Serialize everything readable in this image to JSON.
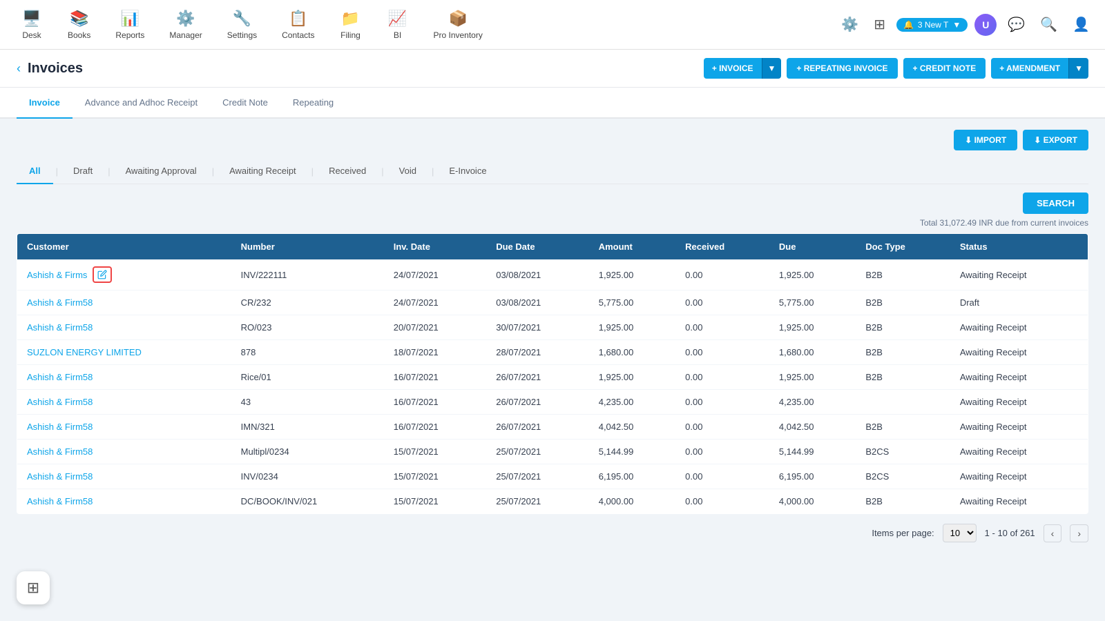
{
  "nav": {
    "items": [
      {
        "id": "desk",
        "label": "Desk",
        "icon": "🖥️"
      },
      {
        "id": "books",
        "label": "Books",
        "icon": "📚"
      },
      {
        "id": "reports",
        "label": "Reports",
        "icon": "📊"
      },
      {
        "id": "manager",
        "label": "Manager",
        "icon": "⚙️"
      },
      {
        "id": "settings",
        "label": "Settings",
        "icon": "🔧"
      },
      {
        "id": "contacts",
        "label": "Contacts",
        "icon": "📋"
      },
      {
        "id": "filing",
        "label": "Filing",
        "icon": "📁"
      },
      {
        "id": "bi",
        "label": "BI",
        "icon": "📈"
      },
      {
        "id": "pro-inventory",
        "label": "Pro Inventory",
        "icon": "📦"
      }
    ],
    "notifications_label": "3 New T",
    "notification_icon": "🔔",
    "search_icon": "🔍",
    "grid_icon": "⊞",
    "gear_icon": "⚙️",
    "chevron_icon": "▼",
    "user_initial": "U"
  },
  "page": {
    "title": "Invoices",
    "back_label": "‹"
  },
  "header_buttons": {
    "invoice_label": "+ INVOICE",
    "repeating_label": "+ REPEATING INVOICE",
    "credit_note_label": "+ CREDIT NOTE",
    "amendment_label": "+ AMENDMENT"
  },
  "tabs": [
    {
      "id": "invoice",
      "label": "Invoice",
      "active": true
    },
    {
      "id": "advance",
      "label": "Advance and Adhoc Receipt",
      "active": false
    },
    {
      "id": "credit-note",
      "label": "Credit Note",
      "active": false
    },
    {
      "id": "repeating",
      "label": "Repeating",
      "active": false
    }
  ],
  "action_buttons": {
    "import_label": "⬇ IMPORT",
    "export_label": "⬇ EXPORT"
  },
  "filter_tabs": [
    {
      "id": "all",
      "label": "All",
      "active": true
    },
    {
      "id": "draft",
      "label": "Draft",
      "active": false
    },
    {
      "id": "awaiting-approval",
      "label": "Awaiting Approval",
      "active": false
    },
    {
      "id": "awaiting-receipt",
      "label": "Awaiting Receipt",
      "active": false
    },
    {
      "id": "received",
      "label": "Received",
      "active": false
    },
    {
      "id": "void",
      "label": "Void",
      "active": false
    },
    {
      "id": "e-invoice",
      "label": "E-Invoice",
      "active": false
    }
  ],
  "search_button_label": "SEARCH",
  "total_info": "Total 31,072.49 INR due from current invoices",
  "table": {
    "headers": [
      "Customer",
      "Number",
      "Inv. Date",
      "Due Date",
      "Amount",
      "Received",
      "Due",
      "Doc Type",
      "Status"
    ],
    "rows": [
      {
        "customer": "Ashish & Firms",
        "number": "INV/222111",
        "inv_date": "24/07/2021",
        "due_date": "03/08/2021",
        "amount": "1,925.00",
        "received": "0.00",
        "due": "1,925.00",
        "doc_type": "B2B",
        "status": "Awaiting Receipt",
        "has_edit_icon": true
      },
      {
        "customer": "Ashish & Firm58",
        "number": "CR/232",
        "inv_date": "24/07/2021",
        "due_date": "03/08/2021",
        "amount": "5,775.00",
        "received": "0.00",
        "due": "5,775.00",
        "doc_type": "B2B",
        "status": "Draft",
        "has_edit_icon": false
      },
      {
        "customer": "Ashish & Firm58",
        "number": "RO/023",
        "inv_date": "20/07/2021",
        "due_date": "30/07/2021",
        "amount": "1,925.00",
        "received": "0.00",
        "due": "1,925.00",
        "doc_type": "B2B",
        "status": "Awaiting Receipt",
        "has_edit_icon": false
      },
      {
        "customer": "SUZLON ENERGY LIMITED",
        "number": "878",
        "inv_date": "18/07/2021",
        "due_date": "28/07/2021",
        "amount": "1,680.00",
        "received": "0.00",
        "due": "1,680.00",
        "doc_type": "B2B",
        "status": "Awaiting Receipt",
        "has_edit_icon": false
      },
      {
        "customer": "Ashish & Firm58",
        "number": "Rice/01",
        "inv_date": "16/07/2021",
        "due_date": "26/07/2021",
        "amount": "1,925.00",
        "received": "0.00",
        "due": "1,925.00",
        "doc_type": "B2B",
        "status": "Awaiting Receipt",
        "has_edit_icon": false
      },
      {
        "customer": "Ashish & Firm58",
        "number": "43",
        "inv_date": "16/07/2021",
        "due_date": "26/07/2021",
        "amount": "4,235.00",
        "received": "0.00",
        "due": "4,235.00",
        "doc_type": "",
        "status": "Awaiting Receipt",
        "has_edit_icon": false
      },
      {
        "customer": "Ashish & Firm58",
        "number": "IMN/321",
        "inv_date": "16/07/2021",
        "due_date": "26/07/2021",
        "amount": "4,042.50",
        "received": "0.00",
        "due": "4,042.50",
        "doc_type": "B2B",
        "status": "Awaiting Receipt",
        "has_edit_icon": false
      },
      {
        "customer": "Ashish & Firm58",
        "number": "Multipl/0234",
        "inv_date": "15/07/2021",
        "due_date": "25/07/2021",
        "amount": "5,144.99",
        "received": "0.00",
        "due": "5,144.99",
        "doc_type": "B2CS",
        "status": "Awaiting Receipt",
        "has_edit_icon": false
      },
      {
        "customer": "Ashish & Firm58",
        "number": "INV/0234",
        "inv_date": "15/07/2021",
        "due_date": "25/07/2021",
        "amount": "6,195.00",
        "received": "0.00",
        "due": "6,195.00",
        "doc_type": "B2CS",
        "status": "Awaiting Receipt",
        "has_edit_icon": false
      },
      {
        "customer": "Ashish & Firm58",
        "number": "DC/BOOK/INV/021",
        "inv_date": "15/07/2021",
        "due_date": "25/07/2021",
        "amount": "4,000.00",
        "received": "0.00",
        "due": "4,000.00",
        "doc_type": "B2B",
        "status": "Awaiting Receipt",
        "has_edit_icon": false
      }
    ]
  },
  "pagination": {
    "items_per_page_label": "Items per page:",
    "items_per_page": "10",
    "page_info": "1 - 10 of 261",
    "total_pages": "261",
    "prev_icon": "‹",
    "next_icon": "›"
  },
  "fab_icon": "⊞"
}
